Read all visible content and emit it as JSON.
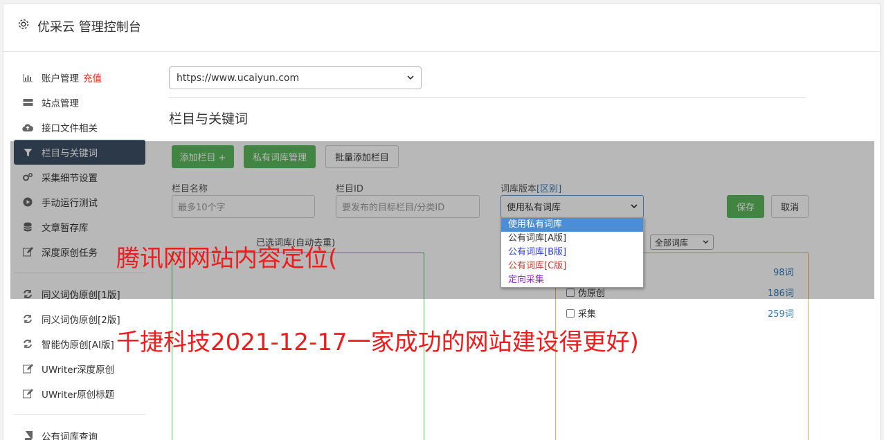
{
  "header": {
    "title": "优采云 管理控制台"
  },
  "sidebar": {
    "items": [
      {
        "label": "账户管理",
        "extra": "充值",
        "icon": "bar-chart-icon"
      },
      {
        "label": "站点管理",
        "icon": "server-icon"
      },
      {
        "label": "接口文件相关",
        "icon": "cloud-upload-icon"
      },
      {
        "label": "栏目与关键词",
        "icon": "filter-icon",
        "active": true
      },
      {
        "label": "采集细节设置",
        "icon": "cogs-icon"
      },
      {
        "label": "手动运行测试",
        "icon": "play-circle-icon"
      },
      {
        "label": "文章暂存库",
        "icon": "database-icon"
      },
      {
        "label": "深度原创任务",
        "icon": "edit-icon"
      }
    ],
    "items2": [
      {
        "label": "同义词伪原创[1版]",
        "icon": "refresh-icon"
      },
      {
        "label": "同义词伪原创[2版]",
        "icon": "refresh-icon"
      },
      {
        "label": "智能伪原创[AI版]",
        "icon": "refresh-icon"
      },
      {
        "label": "UWriter深度原创",
        "icon": "edit-icon"
      },
      {
        "label": "UWriter原创标题",
        "icon": "edit-icon"
      }
    ],
    "items3": [
      {
        "label": "公有词库查询",
        "icon": "book-icon"
      }
    ]
  },
  "main": {
    "site_select": "https://www.ucaiyun.com",
    "section_title": "栏目与关键词",
    "buttons": {
      "add_column": "添加栏目 +",
      "private_lib": "私有词库管理",
      "batch_add": "批量添加栏目",
      "save": "保存",
      "cancel": "取消"
    },
    "form": {
      "name_label": "栏目名称",
      "name_placeholder": "最多10个字",
      "id_label": "栏目ID",
      "id_placeholder": "要发布的目标栏目/分类ID",
      "version_label": "词库版本",
      "version_diff": "[区别]",
      "version_value": "使用私有词库"
    },
    "selected_label": "已选词库(自动去重)",
    "all_lib_select": "全部词库",
    "libs": [
      {
        "label": "",
        "count": "98词"
      },
      {
        "label": "伪原创",
        "count": "186词"
      },
      {
        "label": "采集",
        "count": "259词"
      }
    ],
    "dropdown_options": [
      {
        "label": "使用私有词库",
        "color": "#ffffff"
      },
      {
        "label": "公有词库[A版]",
        "color": "#333333"
      },
      {
        "label": "公有词库[B版]",
        "color": "#2b3fd6"
      },
      {
        "label": "公有词库[C版]",
        "color": "#c0392b"
      },
      {
        "label": "定向采集",
        "color": "#8e2cc4"
      }
    ]
  },
  "watermark": {
    "line1": "腾讯网网站内容定位(",
    "line2": "千捷科技2021-12-17一家成功的网站建设得更好)"
  }
}
